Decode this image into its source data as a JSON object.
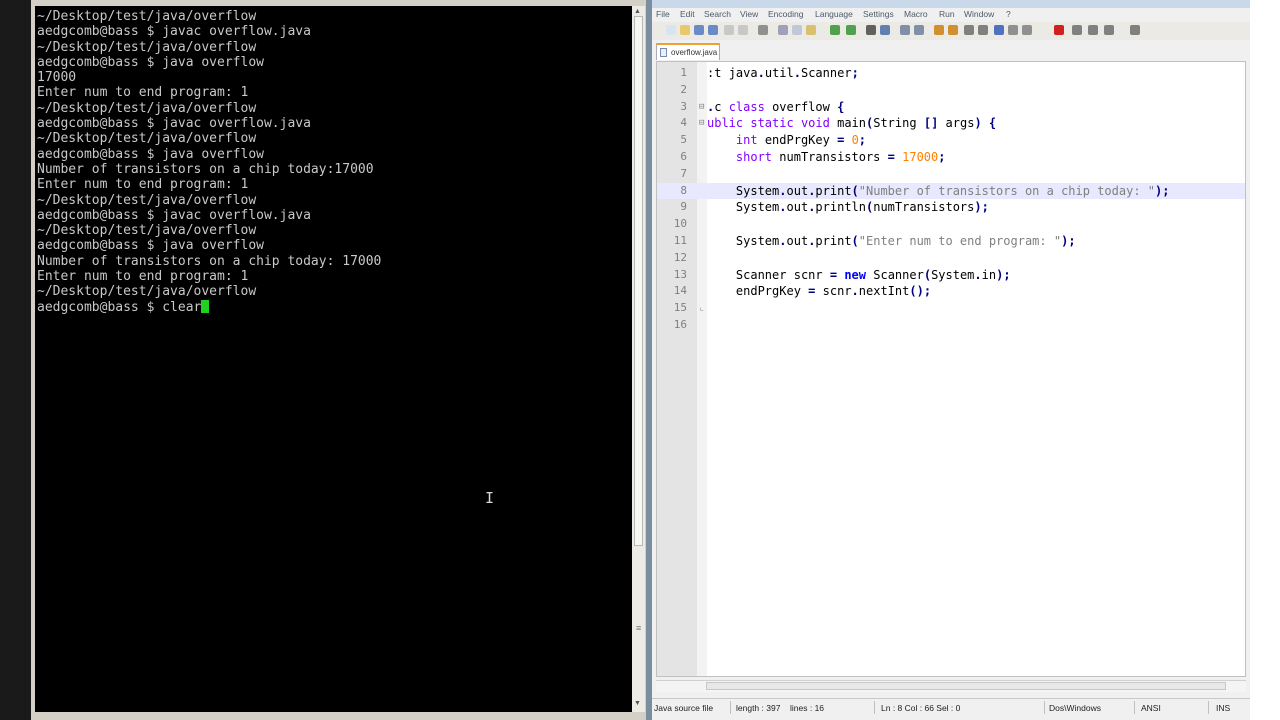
{
  "terminal": {
    "lines": [
      "~/Desktop/test/java/overflow",
      "aedgcomb@bass $ javac overflow.java",
      "~/Desktop/test/java/overflow",
      "aedgcomb@bass $ java overflow",
      "17000",
      "Enter num to end program: 1",
      "~/Desktop/test/java/overflow",
      "aedgcomb@bass $ javac overflow.java",
      "~/Desktop/test/java/overflow",
      "aedgcomb@bass $ java overflow",
      "Number of transistors on a chip today:17000",
      "Enter num to end program: 1",
      "~/Desktop/test/java/overflow",
      "aedgcomb@bass $ javac overflow.java",
      "~/Desktop/test/java/overflow",
      "aedgcomb@bass $ java overflow",
      "Number of transistors on a chip today: 17000",
      "Enter num to end program: 1",
      "~/Desktop/test/java/overflow"
    ],
    "prompt": "aedgcomb@bass $ ",
    "current_input": "clear",
    "cursor_color": "#22d022"
  },
  "editor": {
    "menu": [
      "File",
      "Edit",
      "Search",
      "View",
      "Encoding",
      "Language",
      "Settings",
      "Macro",
      "Run",
      "Window",
      "?"
    ],
    "tab_label": "overflow.java",
    "current_line": 8,
    "lines": [
      {
        "num": "1",
        "fold": "",
        "code": ":t java.util.Scanner;"
      },
      {
        "num": "2",
        "fold": "",
        "code": ""
      },
      {
        "num": "3",
        "fold": "⊟",
        "code": ".c class overflow {"
      },
      {
        "num": "4",
        "fold": "⊟",
        "code": "ublic static void main(String [] args) {"
      },
      {
        "num": "5",
        "fold": "",
        "code": "    int endPrgKey = 0;"
      },
      {
        "num": "6",
        "fold": "",
        "code": "    short numTransistors = 17000;"
      },
      {
        "num": "7",
        "fold": "",
        "code": ""
      },
      {
        "num": "8",
        "fold": "",
        "code": "    System.out.print(\"Number of transistors on a chip today: \");"
      },
      {
        "num": "9",
        "fold": "",
        "code": "    System.out.println(numTransistors);"
      },
      {
        "num": "10",
        "fold": "",
        "code": ""
      },
      {
        "num": "11",
        "fold": "",
        "code": "    System.out.print(\"Enter num to end program: \");"
      },
      {
        "num": "12",
        "fold": "",
        "code": ""
      },
      {
        "num": "13",
        "fold": "",
        "code": "    Scanner scnr = new Scanner(System.in);"
      },
      {
        "num": "14",
        "fold": "",
        "code": "    endPrgKey = scnr.nextInt();"
      },
      {
        "num": "15",
        "fold": "⌞",
        "code": ""
      },
      {
        "num": "16",
        "fold": "",
        "code": ""
      }
    ],
    "status": {
      "file_type": "Java source file",
      "length": "length : 397",
      "lines": "lines : 16",
      "position": "Ln : 8    Col : 66    Sel : 0",
      "eol": "Dos\\Windows",
      "encoding": "ANSI",
      "mode": "INS"
    }
  },
  "colors": {
    "terminal_bg": "#000000",
    "terminal_text": "#c8c8c8",
    "keyword": "#8000ff",
    "number": "#ff8000",
    "string": "#808080",
    "current_line_bg": "#e8e8ff"
  }
}
